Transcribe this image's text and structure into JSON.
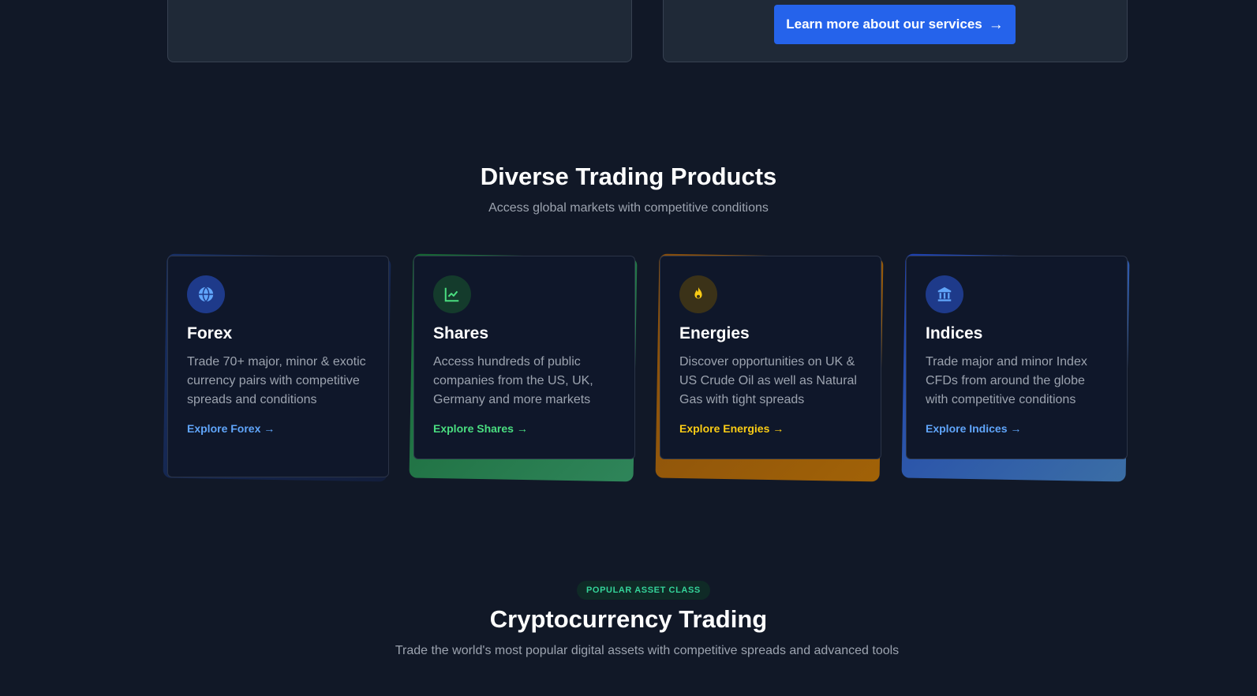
{
  "top_section": {
    "cta_label": "Learn more about our services",
    "cta_arrow": "→"
  },
  "products": {
    "title": "Diverse Trading Products",
    "subtitle": "Access global markets with competitive conditions",
    "cards": [
      {
        "title": "Forex",
        "description": "Trade 70+ major, minor & exotic currency pairs with competitive spreads and conditions",
        "link": "Explore Forex →",
        "icon": "globe-icon",
        "accent": "#60a5fa"
      },
      {
        "title": "Shares",
        "description": "Access hundreds of public companies from the US, UK, Germany and more markets",
        "link": "Explore Shares →",
        "icon": "chart-line-icon",
        "accent": "#4ade80"
      },
      {
        "title": "Energies",
        "description": "Discover opportunities on UK & US Crude Oil as well as Natural Gas with tight spreads",
        "link": "Explore Energies →",
        "icon": "flame-icon",
        "accent": "#facc15"
      },
      {
        "title": "Indices",
        "description": "Trade major and minor Index CFDs from around the globe with competitive conditions",
        "link": "Explore Indices →",
        "icon": "bank-icon",
        "accent": "#60a5fa"
      }
    ]
  },
  "crypto": {
    "badge": "POPULAR ASSET CLASS",
    "title": "Cryptocurrency Trading",
    "subtitle": "Trade the world's most popular digital assets with competitive spreads and advanced tools"
  }
}
